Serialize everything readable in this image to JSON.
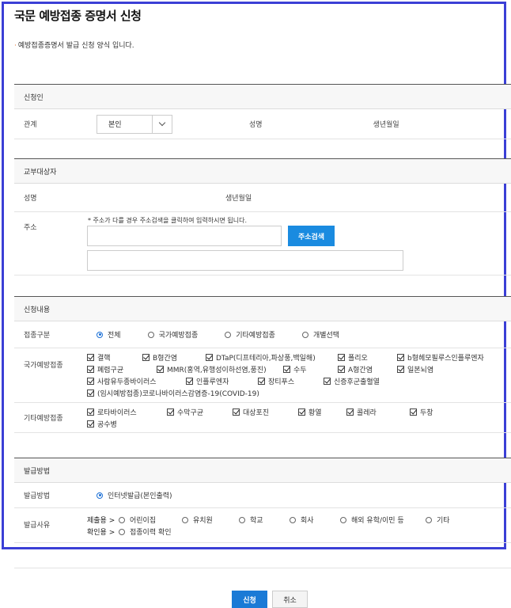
{
  "page": {
    "title": "국문 예방접종 증명서 신청",
    "intro": "예방접종증명서 발급 신청 양식 입니다."
  },
  "applicant": {
    "section_title": "신청인",
    "relation_label": "관계",
    "relation_value": "본인",
    "name_label": "성명",
    "birth_label": "생년월일"
  },
  "recipient": {
    "section_title": "교부대상자",
    "name_label": "성명",
    "birth_label": "생년월일",
    "address_label": "주소",
    "address_hint": "* 주소가 다를 경우 주소검색을 클릭하여 입력하시면 됩니다.",
    "search_button": "주소검색"
  },
  "content": {
    "section_title": "신청내용",
    "type_label": "접종구분",
    "type_options": [
      "전체",
      "국가예방접종",
      "기타예방접종",
      "개별선택"
    ],
    "type_selected": 0,
    "national_label": "국가예방접종",
    "national_items": [
      "결핵",
      "B형간염",
      "DTaP(디프테리아,파상풍,백일해)",
      "폴리오",
      "b형헤모필루스인플루엔자",
      "폐렴구균",
      "MMR(홍역,유행성이하선염,풍진)",
      "수두",
      "A형간염",
      "일본뇌염",
      "사람유두종바이러스",
      "인플루엔자",
      "장티푸스",
      "신증후군출혈열",
      "(임시예방접종)코로나바이러스감염증-19(COVID-19)"
    ],
    "other_label": "기타예방접종",
    "other_items": [
      "로타바이러스",
      "수막구균",
      "대상포진",
      "황열",
      "콜레라",
      "두창",
      "공수병"
    ]
  },
  "issue": {
    "section_title": "발급방법",
    "method_label": "발급방법",
    "method_value": "인터넷발급(본인출력)",
    "reason_label": "발급사유",
    "submit_prefix": "제출용 >",
    "submit_options": [
      "어린이집",
      "유치원",
      "학교",
      "회사",
      "해외 유학/이민 등",
      "기타"
    ],
    "check_prefix": "확인용 >",
    "check_options": [
      "접종이력 확인"
    ]
  },
  "footer": {
    "apply_button": "신청",
    "cancel_button": "취소"
  },
  "colors": {
    "frame": "#3b3fd6",
    "accent_blue": "#1a8be0",
    "intro_dot": "#e8732c"
  }
}
